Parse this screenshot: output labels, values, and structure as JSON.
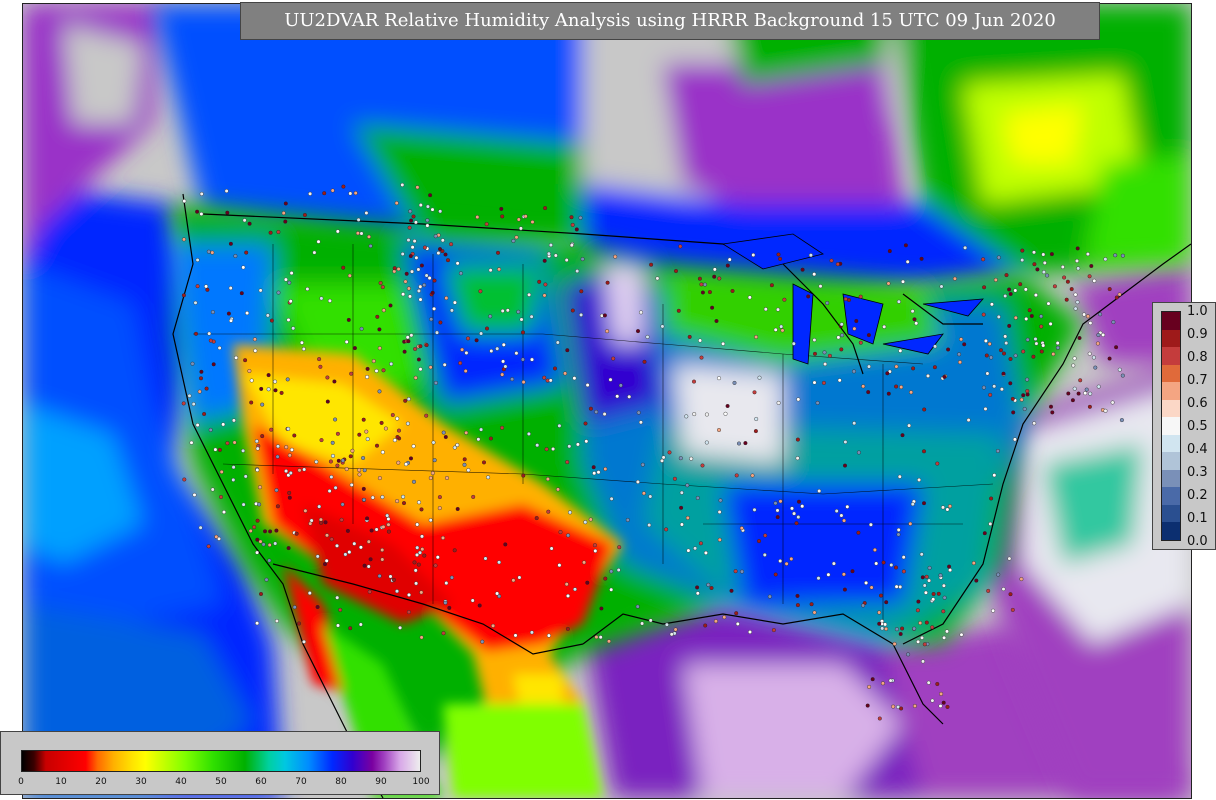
{
  "title": "UU2DVAR Relative Humidity Analysis using HRRR Background 15 UTC 09 Jun 2020",
  "obs_legend": {
    "labels": [
      "1.0",
      "0.9",
      "0.8",
      "0.7",
      "0.6",
      "0.5",
      "0.4",
      "0.3",
      "0.2",
      "0.1",
      "0.0"
    ],
    "colors": [
      "#67001f",
      "#9e1a1a",
      "#c43c3c",
      "#e06a3a",
      "#f4a582",
      "#fbd7c6",
      "#f7f7f7",
      "#d1e5f0",
      "#b0c4d8",
      "#7a90b8",
      "#4a6aa8",
      "#2a4f90",
      "#0c2f70"
    ]
  },
  "rh_legend": {
    "ticks": [
      "0",
      "10",
      "20",
      "30",
      "40",
      "50",
      "60",
      "70",
      "80",
      "90",
      "100"
    ]
  },
  "colors": {
    "land_dry": "#ff0000",
    "land_mid": "#00b000",
    "land_moist": "#0028ff",
    "ocean_background": "#c8c8c8"
  }
}
